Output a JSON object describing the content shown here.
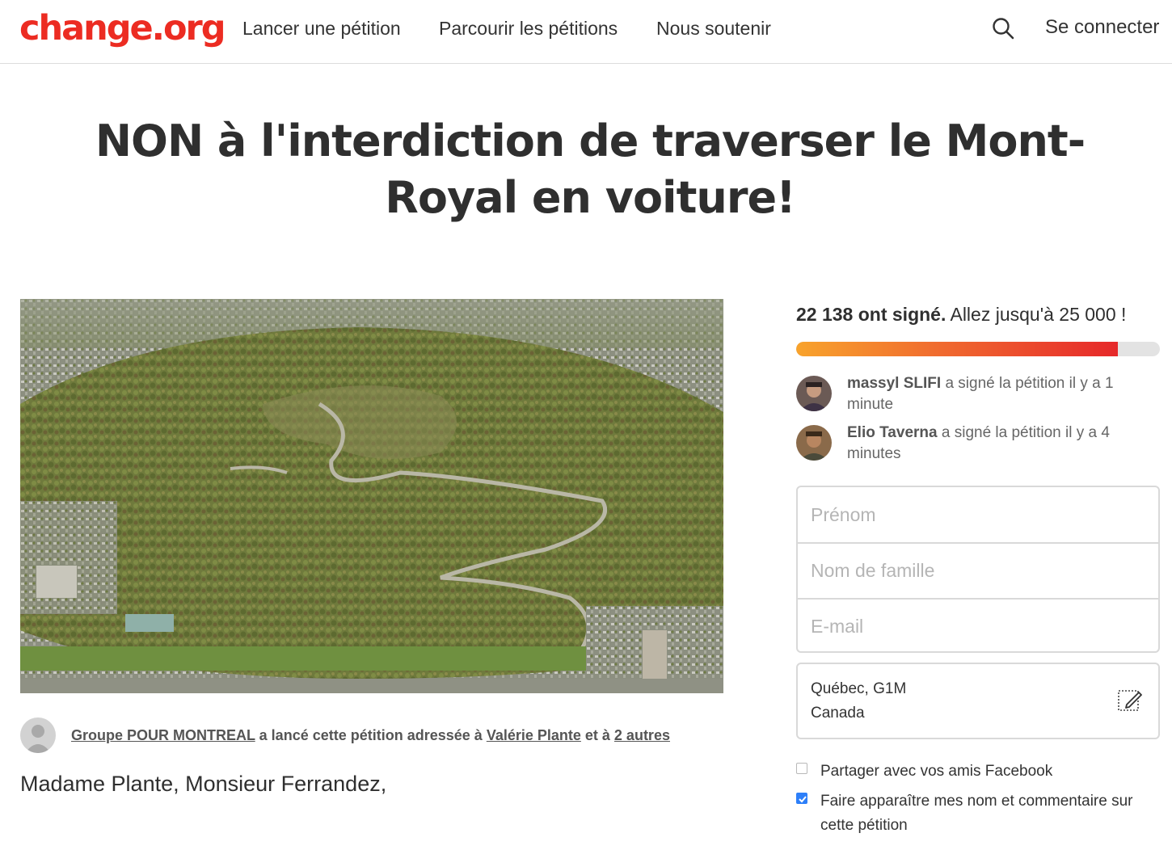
{
  "header": {
    "logo": "change.org",
    "nav": [
      "Lancer une pétition",
      "Parcourir les pétitions",
      "Nous soutenir"
    ],
    "login": "Se connecter"
  },
  "petition": {
    "title": "NON à l'interdiction de traverser le Mont-Royal en voiture!",
    "starter": {
      "org": "Groupe POUR MONTREAL",
      "text1": " a lancé cette pétition adressée à ",
      "target": "Valérie Plante",
      "text2": " et à ",
      "others": "2 autres"
    },
    "salutation": "Madame Plante, Monsieur Ferrandez,"
  },
  "signatures": {
    "count": "22 138 ont signé.",
    "goal": " Allez jusqu'à 25 000 !",
    "progress_fraction": 0.8855,
    "recent": [
      {
        "name": "massyl SLIFI",
        "text": " a signé la pétition il y a 1 minute"
      },
      {
        "name": "Elio Taverna",
        "text": " a signé la pétition il y a 4 minutes"
      }
    ]
  },
  "form": {
    "first_name_placeholder": "Prénom",
    "last_name_placeholder": "Nom de famille",
    "email_placeholder": "E-mail",
    "location_line1": "Québec, G1M",
    "location_line2": "Canada",
    "share_facebook": "Partager avec vos amis Facebook",
    "share_facebook_checked": false,
    "display_name": "Faire apparaître mes nom et commentaire sur cette pétition",
    "display_name_checked": true
  },
  "colors": {
    "brand": "#ec2c22",
    "progress_start": "#f8a32c",
    "progress_end": "#e6282a",
    "checkbox": "#2d7ff9"
  },
  "icons": {
    "search": "search-icon",
    "edit": "edit-icon",
    "avatar_placeholder": "person-icon"
  }
}
